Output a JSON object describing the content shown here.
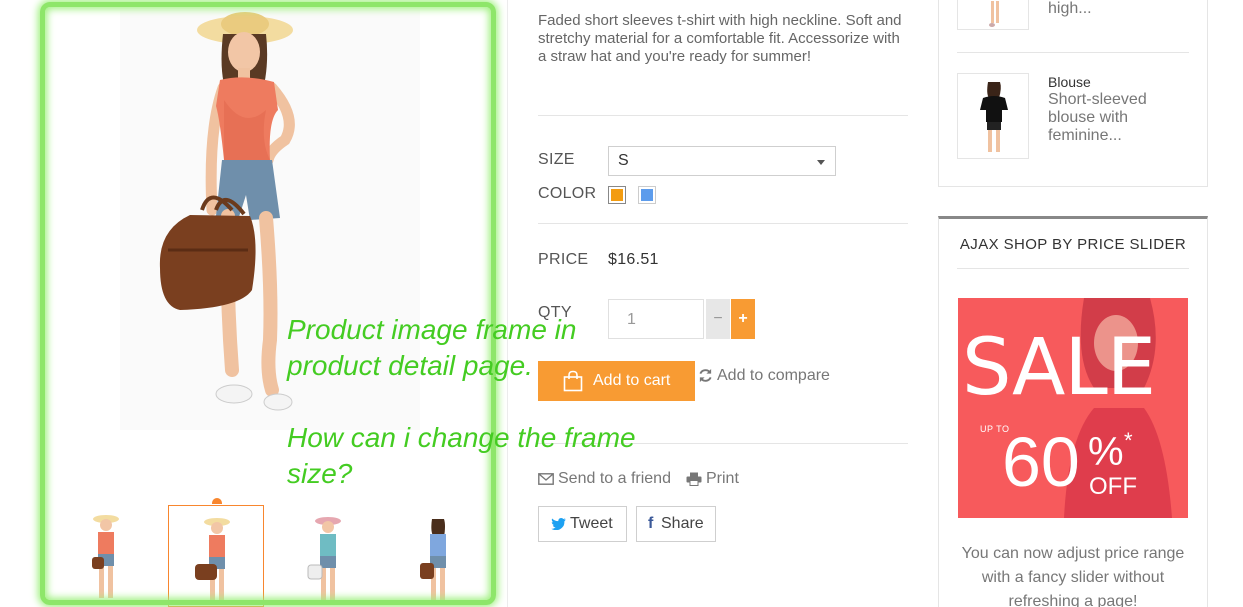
{
  "product": {
    "description": "Faded short sleeves t-shirt with high neckline. Soft and stretchy material for a comfortable fit. Accessorize with a straw hat and you're ready for summer!",
    "size_label": "SIZE",
    "size_value": "S",
    "color_label": "COLOR",
    "colors": [
      "#f39c11",
      "#5d9cec"
    ],
    "price_label": "PRICE",
    "price_value": "$16.51",
    "qty_label": "QTY",
    "qty_value": "1",
    "qty_minus": "−",
    "qty_plus": "+",
    "add_to_cart": "Add to cart",
    "add_to_compare": "Add to compare",
    "send_to_friend": "Send to a friend",
    "print": "Print",
    "tweet": "Tweet",
    "share": "Share",
    "thumbnails": [
      "orange-outfit-front",
      "orange-outfit-with-bag",
      "blue-outfit-with-bag",
      "blue-outfit-side"
    ]
  },
  "annotation": {
    "line1": "Product image frame in\nproduct detail page.",
    "line2": "How can i change the frame\nsize?"
  },
  "sidebar": {
    "related": [
      {
        "name": "",
        "desc": "high..."
      },
      {
        "name": "Blouse",
        "desc": "Short-sleeved blouse with feminine..."
      }
    ],
    "price_slider_title": "AJAX SHOP BY PRICE SLIDER",
    "banner": {
      "sale": "SALE",
      "upto": "UP TO",
      "sixty": "60",
      "pct": "%",
      "off": "OFF",
      "star": "*"
    },
    "slider_text": "You can now adjust price range with a fancy slider without refreshing a page!"
  },
  "colors": {
    "accent": "#f89b33",
    "highlight": "#8ee66a",
    "annotation": "#44cc22",
    "banner": "#f75a5c"
  }
}
